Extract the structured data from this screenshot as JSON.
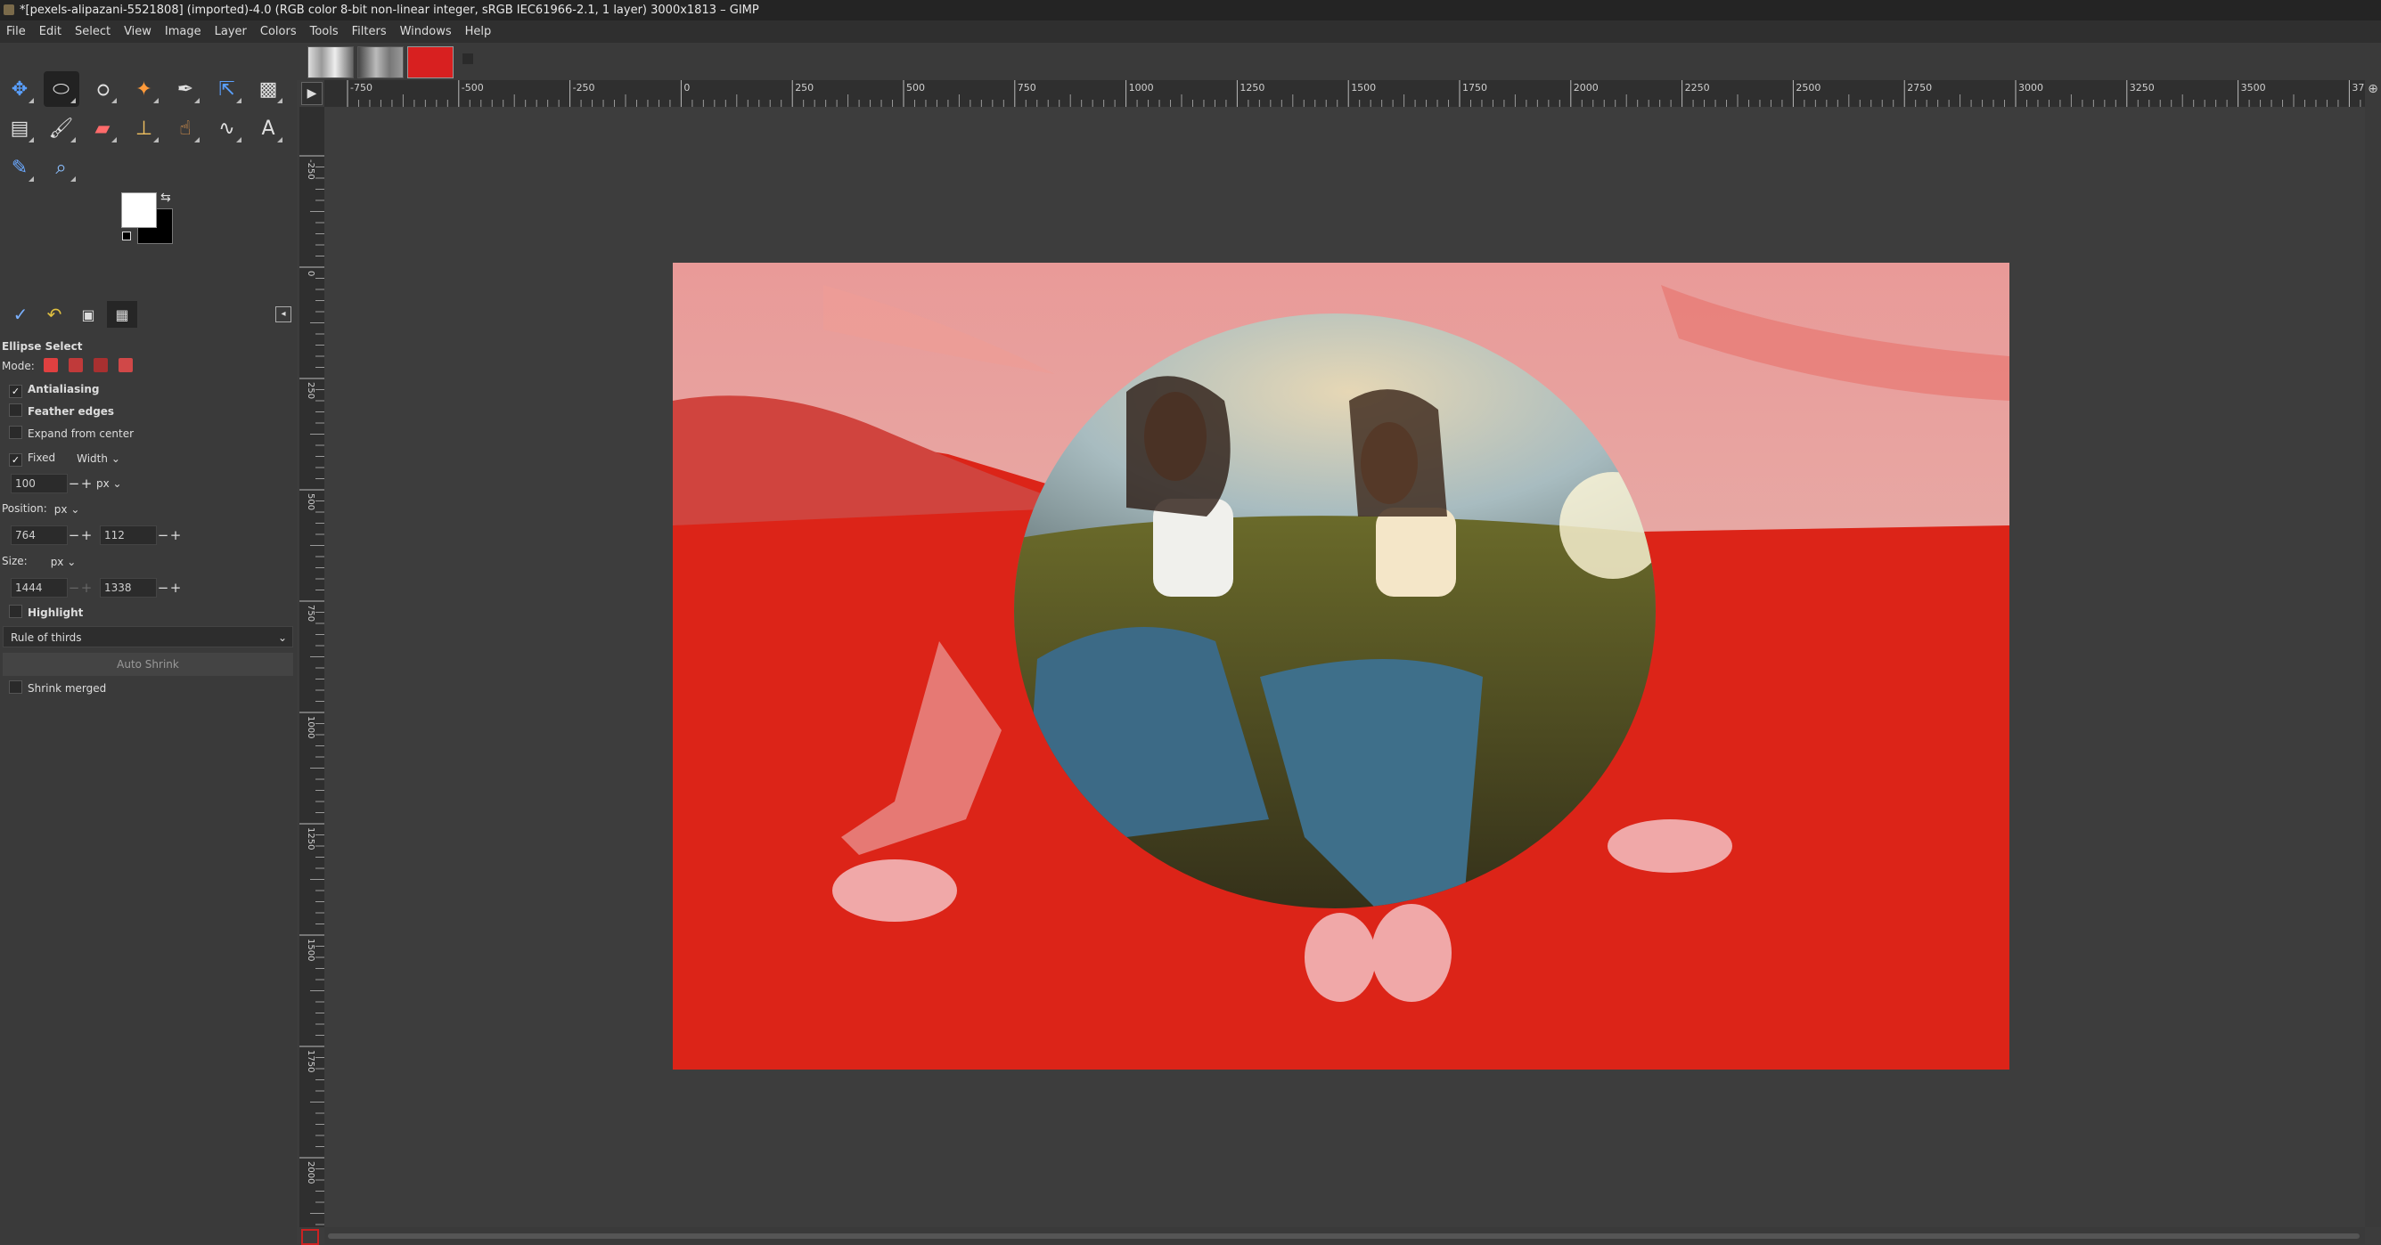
{
  "window": {
    "title": "*[pexels-alipazani-5521808] (imported)-4.0 (RGB color 8-bit non-linear integer, sRGB IEC61966-2.1, 1 layer) 3000x1813 – GIMP"
  },
  "menu": [
    "File",
    "Edit",
    "Select",
    "View",
    "Image",
    "Layer",
    "Colors",
    "Tools",
    "Filters",
    "Windows",
    "Help"
  ],
  "toolbox": {
    "tools": [
      {
        "name": "move-tool-icon"
      },
      {
        "name": "ellipse-select-icon",
        "active": true
      },
      {
        "name": "lasso-icon"
      },
      {
        "name": "fuzzy-select-icon"
      },
      {
        "name": "pen-icon"
      },
      {
        "name": "transform-icon"
      },
      {
        "name": "checker-icon"
      },
      {
        "name": "gradient-icon"
      },
      {
        "name": "paintbrush-icon"
      },
      {
        "name": "eraser-icon"
      },
      {
        "name": "clone-stamp-icon"
      },
      {
        "name": "smudge-icon"
      },
      {
        "name": "paths-icon"
      },
      {
        "name": "text-icon"
      },
      {
        "name": "color-picker-icon"
      },
      {
        "name": "zoom-icon"
      }
    ],
    "fg_color": "#ffffff",
    "bg_color": "#000000"
  },
  "tool_options": {
    "title": "Ellipse Select",
    "mode_label": "Mode:",
    "antialiasing": {
      "label": "Antialiasing",
      "checked": true
    },
    "feather_edges": {
      "label": "Feather edges",
      "checked": false
    },
    "expand_from_center": {
      "label": "Expand from center",
      "checked": false
    },
    "fixed": {
      "label": "Fixed",
      "checked": true,
      "option": "Width"
    },
    "fixed_value": "100",
    "fixed_unit": "px",
    "position": {
      "label": "Position:",
      "unit": "px",
      "x": "764",
      "y": "112"
    },
    "size": {
      "label": "Size:",
      "unit": "px",
      "w": "1444",
      "h": "1338"
    },
    "highlight": {
      "label": "Highlight",
      "checked": false
    },
    "guides": "Rule of thirds",
    "auto_shrink": "Auto Shrink",
    "shrink_merged": {
      "label": "Shrink merged",
      "checked": false
    }
  },
  "rulers": {
    "h_labels": [
      "-750",
      "-500",
      "-250",
      "0",
      "250",
      "500",
      "750",
      "1000",
      "1250",
      "1500",
      "1750",
      "2000",
      "2250",
      "2500",
      "2750",
      "3000",
      "3250",
      "3500",
      "37"
    ],
    "v_labels": [
      "-250",
      "0",
      "250",
      "500",
      "750",
      "1000",
      "1250",
      "1500",
      "1750",
      "2000"
    ]
  },
  "colors": {
    "mask": "#e8251f",
    "dark_bg": "#3d3d3d"
  }
}
